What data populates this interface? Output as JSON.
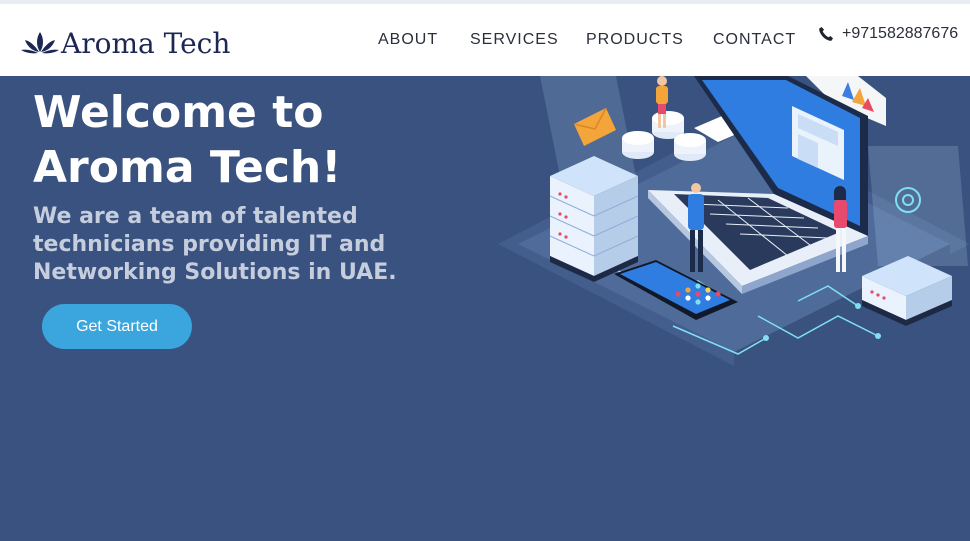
{
  "brand": {
    "name": "Aroma Tech",
    "logo_icon": "lotus-icon",
    "color": "#1c2754"
  },
  "nav": {
    "items": [
      {
        "label": "ABOUT"
      },
      {
        "label": "SERVICES"
      },
      {
        "label": "PRODUCTS"
      },
      {
        "label": "CONTACT"
      }
    ]
  },
  "contact": {
    "phone_icon": "phone-icon",
    "phone": "+971582887676"
  },
  "hero": {
    "title": "Welcome to Aroma Tech!",
    "subtitle": "We are a team of talented technicians providing IT and Networking Solutions in UAE.",
    "cta_label": "Get Started",
    "background": "#39527f",
    "accent": "#3ba6dd",
    "illustration": "isometric-it-network-illustration"
  }
}
